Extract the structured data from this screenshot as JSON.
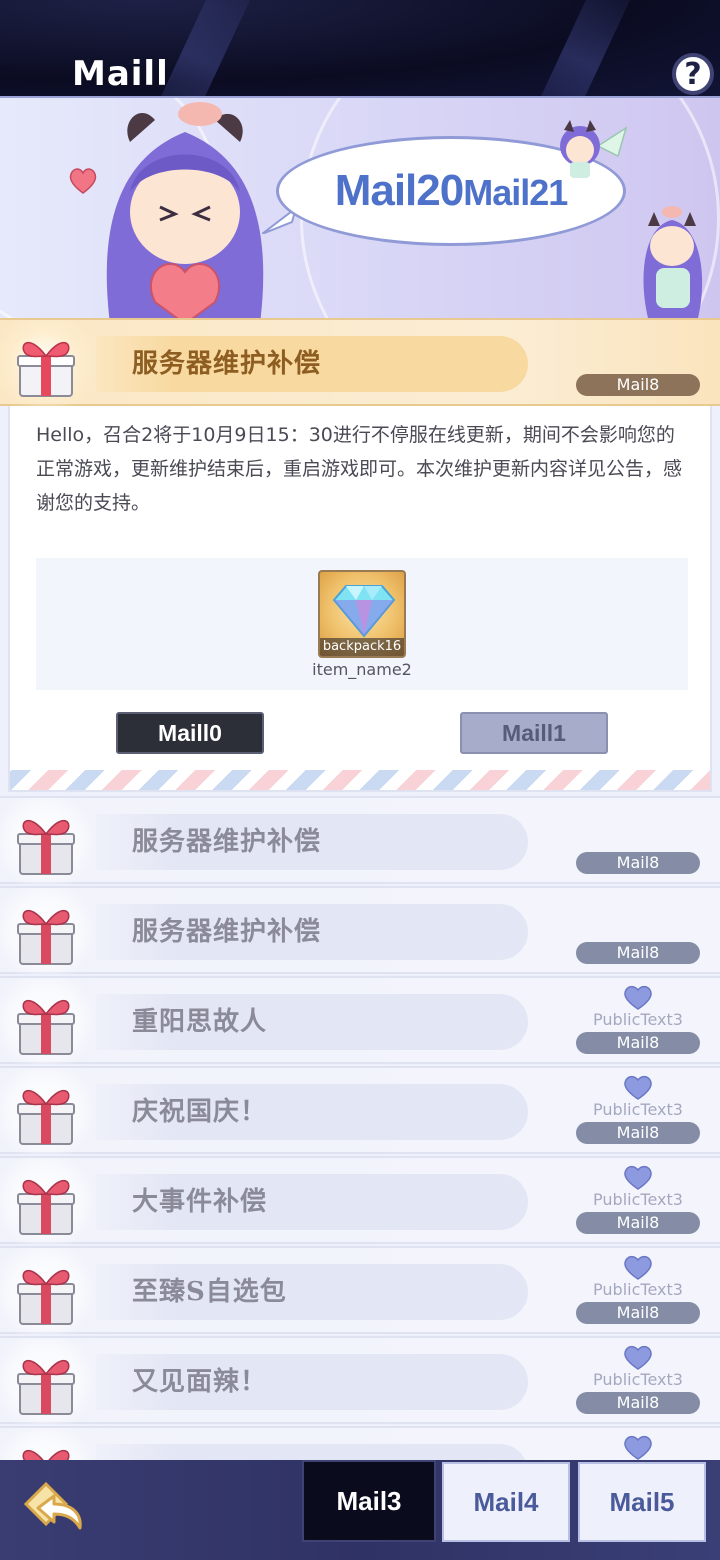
{
  "header": {
    "title": "Maill",
    "help_label": "?"
  },
  "banner": {
    "speech_main": "Mail20",
    "speech_small": "Mail21"
  },
  "open_mail": {
    "title": "服务器维护补偿",
    "badge": "Mail8",
    "body": "Hello，召合2将于10月9日15：30进行不停服在线更新，期间不会影响您的正常游戏，更新维护结束后，重启游戏即可。本次维护更新内容详见公告，感谢您的支持。",
    "attachment": {
      "tag": "backpack16",
      "name": "item_name2",
      "icon": "diamond-icon"
    },
    "buttons": {
      "primary": "Maill0",
      "secondary": "Maill1"
    }
  },
  "mail_list": [
    {
      "title": "服务器维护补偿",
      "badge": "Mail8",
      "status_text": ""
    },
    {
      "title": "服务器维护补偿",
      "badge": "Mail8",
      "status_text": ""
    },
    {
      "title": "重阳思故人",
      "badge": "Mail8",
      "status_text": "PublicText3"
    },
    {
      "title": "庆祝国庆！",
      "badge": "Mail8",
      "status_text": "PublicText3"
    },
    {
      "title": "大事件补偿",
      "badge": "Mail8",
      "status_text": "PublicText3"
    },
    {
      "title": "至臻S自选包",
      "badge": "Mail8",
      "status_text": "PublicText3"
    },
    {
      "title": "又见面辣！",
      "badge": "Mail8",
      "status_text": "PublicText3"
    }
  ],
  "bottom_tabs": {
    "active": "Mail3",
    "tab2": "Mail4",
    "tab3": "Mail5"
  },
  "colors": {
    "accent_gold": "#f8d9a0",
    "badge_grey": "#858da6",
    "tab_active_bg": "#0a0b1c"
  }
}
